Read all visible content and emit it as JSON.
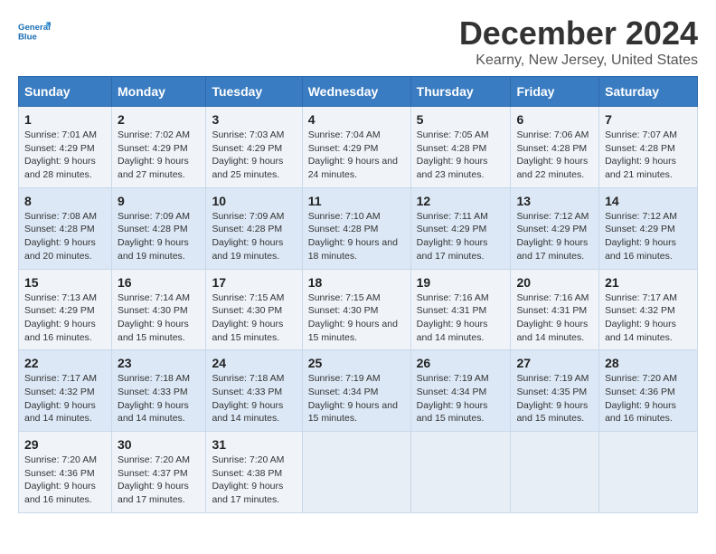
{
  "logo": {
    "line1": "General",
    "line2": "Blue"
  },
  "title": "December 2024",
  "subtitle": "Kearny, New Jersey, United States",
  "days_of_week": [
    "Sunday",
    "Monday",
    "Tuesday",
    "Wednesday",
    "Thursday",
    "Friday",
    "Saturday"
  ],
  "weeks": [
    [
      {
        "day": "1",
        "info": "Sunrise: 7:01 AM\nSunset: 4:29 PM\nDaylight: 9 hours and 28 minutes."
      },
      {
        "day": "2",
        "info": "Sunrise: 7:02 AM\nSunset: 4:29 PM\nDaylight: 9 hours and 27 minutes."
      },
      {
        "day": "3",
        "info": "Sunrise: 7:03 AM\nSunset: 4:29 PM\nDaylight: 9 hours and 25 minutes."
      },
      {
        "day": "4",
        "info": "Sunrise: 7:04 AM\nSunset: 4:29 PM\nDaylight: 9 hours and 24 minutes."
      },
      {
        "day": "5",
        "info": "Sunrise: 7:05 AM\nSunset: 4:28 PM\nDaylight: 9 hours and 23 minutes."
      },
      {
        "day": "6",
        "info": "Sunrise: 7:06 AM\nSunset: 4:28 PM\nDaylight: 9 hours and 22 minutes."
      },
      {
        "day": "7",
        "info": "Sunrise: 7:07 AM\nSunset: 4:28 PM\nDaylight: 9 hours and 21 minutes."
      }
    ],
    [
      {
        "day": "8",
        "info": "Sunrise: 7:08 AM\nSunset: 4:28 PM\nDaylight: 9 hours and 20 minutes."
      },
      {
        "day": "9",
        "info": "Sunrise: 7:09 AM\nSunset: 4:28 PM\nDaylight: 9 hours and 19 minutes."
      },
      {
        "day": "10",
        "info": "Sunrise: 7:09 AM\nSunset: 4:28 PM\nDaylight: 9 hours and 19 minutes."
      },
      {
        "day": "11",
        "info": "Sunrise: 7:10 AM\nSunset: 4:28 PM\nDaylight: 9 hours and 18 minutes."
      },
      {
        "day": "12",
        "info": "Sunrise: 7:11 AM\nSunset: 4:29 PM\nDaylight: 9 hours and 17 minutes."
      },
      {
        "day": "13",
        "info": "Sunrise: 7:12 AM\nSunset: 4:29 PM\nDaylight: 9 hours and 17 minutes."
      },
      {
        "day": "14",
        "info": "Sunrise: 7:12 AM\nSunset: 4:29 PM\nDaylight: 9 hours and 16 minutes."
      }
    ],
    [
      {
        "day": "15",
        "info": "Sunrise: 7:13 AM\nSunset: 4:29 PM\nDaylight: 9 hours and 16 minutes."
      },
      {
        "day": "16",
        "info": "Sunrise: 7:14 AM\nSunset: 4:30 PM\nDaylight: 9 hours and 15 minutes."
      },
      {
        "day": "17",
        "info": "Sunrise: 7:15 AM\nSunset: 4:30 PM\nDaylight: 9 hours and 15 minutes."
      },
      {
        "day": "18",
        "info": "Sunrise: 7:15 AM\nSunset: 4:30 PM\nDaylight: 9 hours and 15 minutes."
      },
      {
        "day": "19",
        "info": "Sunrise: 7:16 AM\nSunset: 4:31 PM\nDaylight: 9 hours and 14 minutes."
      },
      {
        "day": "20",
        "info": "Sunrise: 7:16 AM\nSunset: 4:31 PM\nDaylight: 9 hours and 14 minutes."
      },
      {
        "day": "21",
        "info": "Sunrise: 7:17 AM\nSunset: 4:32 PM\nDaylight: 9 hours and 14 minutes."
      }
    ],
    [
      {
        "day": "22",
        "info": "Sunrise: 7:17 AM\nSunset: 4:32 PM\nDaylight: 9 hours and 14 minutes."
      },
      {
        "day": "23",
        "info": "Sunrise: 7:18 AM\nSunset: 4:33 PM\nDaylight: 9 hours and 14 minutes."
      },
      {
        "day": "24",
        "info": "Sunrise: 7:18 AM\nSunset: 4:33 PM\nDaylight: 9 hours and 14 minutes."
      },
      {
        "day": "25",
        "info": "Sunrise: 7:19 AM\nSunset: 4:34 PM\nDaylight: 9 hours and 15 minutes."
      },
      {
        "day": "26",
        "info": "Sunrise: 7:19 AM\nSunset: 4:34 PM\nDaylight: 9 hours and 15 minutes."
      },
      {
        "day": "27",
        "info": "Sunrise: 7:19 AM\nSunset: 4:35 PM\nDaylight: 9 hours and 15 minutes."
      },
      {
        "day": "28",
        "info": "Sunrise: 7:20 AM\nSunset: 4:36 PM\nDaylight: 9 hours and 16 minutes."
      }
    ],
    [
      {
        "day": "29",
        "info": "Sunrise: 7:20 AM\nSunset: 4:36 PM\nDaylight: 9 hours and 16 minutes."
      },
      {
        "day": "30",
        "info": "Sunrise: 7:20 AM\nSunset: 4:37 PM\nDaylight: 9 hours and 17 minutes."
      },
      {
        "day": "31",
        "info": "Sunrise: 7:20 AM\nSunset: 4:38 PM\nDaylight: 9 hours and 17 minutes."
      },
      null,
      null,
      null,
      null
    ]
  ]
}
